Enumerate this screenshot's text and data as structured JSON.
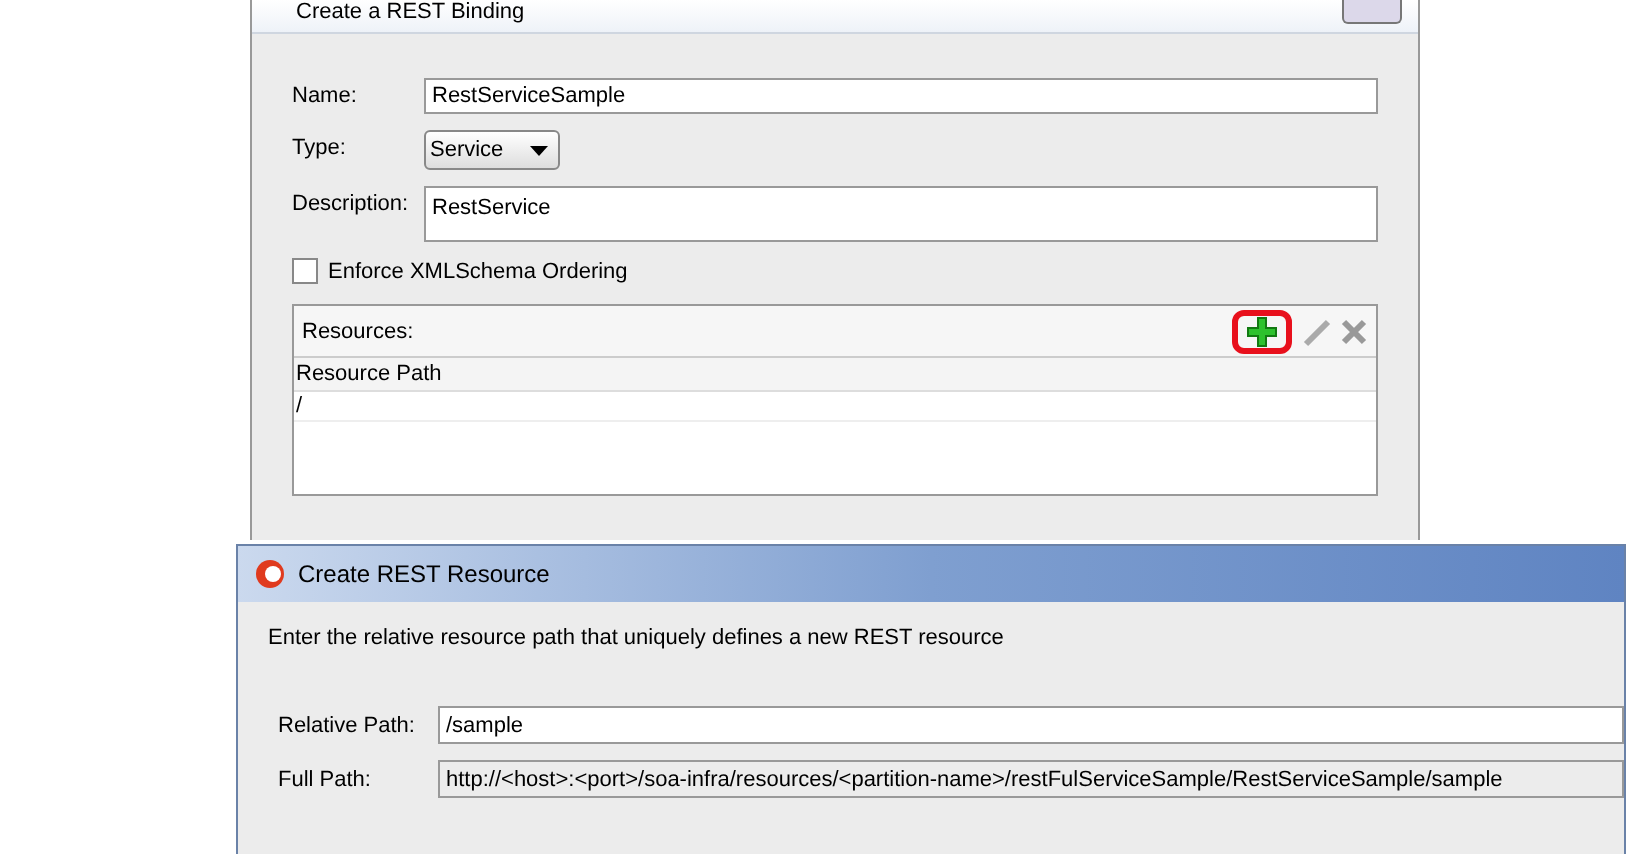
{
  "back_dialog": {
    "title": "Create a REST Binding",
    "fields": [
      {
        "kind": "text",
        "label": "Name:",
        "value": "RestServiceSample"
      },
      {
        "kind": "select",
        "label": "Type:",
        "value": "Service"
      },
      {
        "kind": "textarea",
        "label": "Description:",
        "value": "RestService"
      }
    ],
    "enforce_ordering": {
      "label": "Enforce XMLSchema Ordering",
      "checked": false
    },
    "resources": {
      "label": "Resources:",
      "add_highlighted": true,
      "columns": [
        "Resource Path"
      ],
      "rows": [
        {
          "path": "/",
          "selected": false
        }
      ]
    }
  },
  "front_dialog": {
    "title": "Create REST Resource",
    "instruction": "Enter the relative resource path that uniquely defines a new REST resource",
    "fields": [
      {
        "label": "Relative Path:",
        "value": "/sample",
        "editable": true
      },
      {
        "label": "Full Path:",
        "value": "http://<host>:<port>/soa-infra/resources/<partition-name>/restFulServiceSample/RestServiceSample/sample",
        "editable": false
      }
    ]
  }
}
